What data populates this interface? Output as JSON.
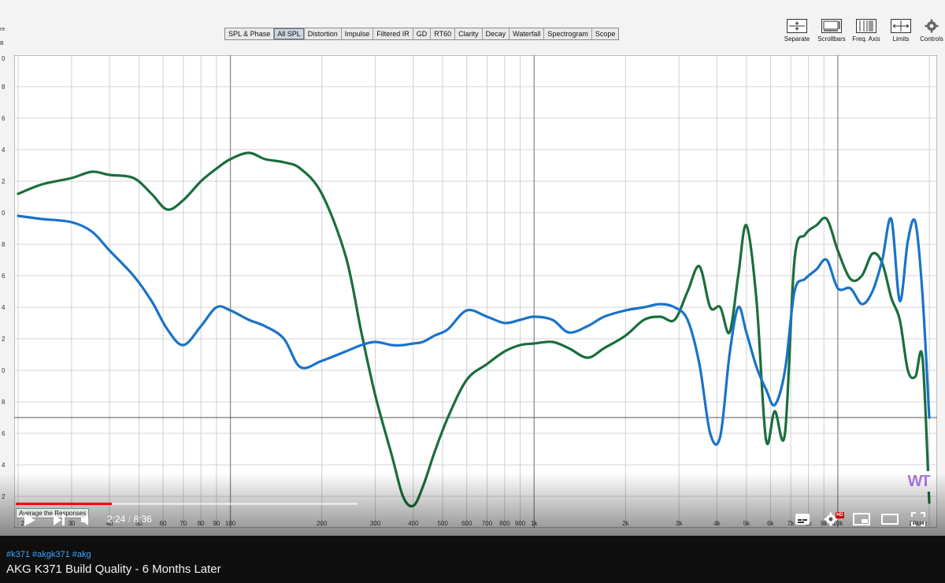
{
  "app": {
    "tabs": [
      {
        "label": "SPL & Phase",
        "active": false
      },
      {
        "label": "All SPL",
        "active": true
      },
      {
        "label": "Distortion",
        "active": false
      },
      {
        "label": "Impulse",
        "active": false
      },
      {
        "label": "Filtered IR",
        "active": false
      },
      {
        "label": "GD",
        "active": false
      },
      {
        "label": "RT60",
        "active": false
      },
      {
        "label": "Clarity",
        "active": false
      },
      {
        "label": "Decay",
        "active": false
      },
      {
        "label": "Waterfall",
        "active": false
      },
      {
        "label": "Spectrogram",
        "active": false
      },
      {
        "label": "Scope",
        "active": false
      }
    ],
    "tools": [
      {
        "label": "Separate",
        "icon": "separate-icon"
      },
      {
        "label": "Scrollbars",
        "icon": "scrollbars-icon"
      },
      {
        "label": "Freq. Axis",
        "icon": "freq-axis-icon"
      },
      {
        "label": "Limits",
        "icon": "limits-icon"
      },
      {
        "label": "Controls",
        "icon": "gear-icon"
      }
    ],
    "left_labels": [
      "re",
      "B"
    ],
    "ytick_labels": [
      "0",
      "8",
      "6",
      "4",
      "2",
      "0",
      "8",
      "6",
      "4",
      "2",
      "0",
      "8",
      "6",
      "4",
      "2"
    ],
    "average_label": "Average the Responses",
    "watermark": "WT"
  },
  "chart_data": {
    "type": "line",
    "x_scale": "log",
    "xlim": [
      20,
      20000
    ],
    "ylim": [
      0,
      15
    ],
    "grid": true,
    "reference_line_y": 3.5,
    "x_tick_labels": [
      "20",
      "30",
      "40",
      "50",
      "60",
      "70",
      "80",
      "90",
      "100",
      "200",
      "300",
      "400",
      "500",
      "600",
      "700",
      "800",
      "900",
      "1k",
      "2k",
      "3k",
      "4k",
      "5k",
      "6k",
      "7k",
      "8k",
      "9k",
      "10k",
      "20kHz"
    ],
    "series": [
      {
        "color": "#1a6e3c",
        "x": [
          20,
          24,
          30,
          35,
          40,
          48,
          55,
          62,
          70,
          80,
          90,
          100,
          115,
          130,
          150,
          170,
          200,
          240,
          270,
          300,
          340,
          370,
          400,
          430,
          470,
          520,
          600,
          700,
          800,
          900,
          1000,
          1150,
          1300,
          1500,
          1700,
          2000,
          2300,
          2600,
          2900,
          3200,
          3500,
          3800,
          4100,
          4400,
          4700,
          5000,
          5400,
          5800,
          6200,
          6700,
          7200,
          7800,
          8500,
          9200,
          10000,
          11000,
          12000,
          13000,
          14000,
          15000,
          16000,
          17000,
          18000,
          19000,
          20000
        ],
        "values": [
          10.6,
          10.9,
          11.1,
          11.3,
          11.2,
          11.1,
          10.6,
          10.1,
          10.4,
          11.0,
          11.4,
          11.7,
          11.9,
          11.7,
          11.6,
          11.4,
          10.6,
          8.6,
          6.2,
          4.2,
          2.3,
          1.0,
          0.7,
          1.3,
          2.4,
          3.5,
          4.7,
          5.2,
          5.6,
          5.8,
          5.85,
          5.9,
          5.7,
          5.4,
          5.7,
          6.1,
          6.6,
          6.7,
          6.6,
          7.5,
          8.3,
          7.0,
          7.0,
          6.2,
          8.0,
          9.6,
          7.2,
          2.8,
          3.7,
          3.0,
          8.5,
          9.3,
          9.6,
          9.8,
          8.8,
          7.9,
          8.0,
          8.7,
          8.4,
          7.3,
          6.6,
          5.0,
          4.8,
          5.4,
          0.8
        ]
      },
      {
        "color": "#1a73c8",
        "x": [
          20,
          24,
          30,
          35,
          40,
          48,
          55,
          62,
          70,
          80,
          90,
          100,
          115,
          130,
          150,
          170,
          200,
          240,
          270,
          300,
          340,
          370,
          400,
          430,
          470,
          520,
          600,
          700,
          800,
          900,
          1000,
          1150,
          1300,
          1500,
          1700,
          2000,
          2300,
          2600,
          2900,
          3200,
          3500,
          3800,
          4100,
          4400,
          4700,
          5000,
          5400,
          5800,
          6200,
          6700,
          7200,
          7800,
          8500,
          9200,
          10000,
          11000,
          12000,
          13000,
          14000,
          15000,
          16000,
          17000,
          18000,
          19000,
          20000
        ],
        "values": [
          9.9,
          9.8,
          9.7,
          9.4,
          8.8,
          8.0,
          7.2,
          6.3,
          5.8,
          6.4,
          7.0,
          6.9,
          6.6,
          6.4,
          6.0,
          5.1,
          5.3,
          5.6,
          5.8,
          5.9,
          5.8,
          5.8,
          5.85,
          5.9,
          6.1,
          6.3,
          6.9,
          6.7,
          6.5,
          6.6,
          6.7,
          6.6,
          6.2,
          6.4,
          6.7,
          6.9,
          7.0,
          7.1,
          7.0,
          6.6,
          5.2,
          3.0,
          2.9,
          5.5,
          7.0,
          6.2,
          5.1,
          4.4,
          3.9,
          5.0,
          7.5,
          7.9,
          8.2,
          8.5,
          7.6,
          7.6,
          7.1,
          7.5,
          8.5,
          9.8,
          7.2,
          9.1,
          9.7,
          7.4,
          3.5
        ]
      }
    ]
  },
  "player": {
    "time_current": "2:24",
    "time_separator": " / ",
    "time_total": "8:36",
    "progress_fraction": 0.28,
    "buffered_fraction": 1.0,
    "hd_badge": "HD"
  },
  "below": {
    "hashtags": "#k371 #akgk371 #akg",
    "title": "AKG K371 Build Quality - 6 Months Later"
  }
}
